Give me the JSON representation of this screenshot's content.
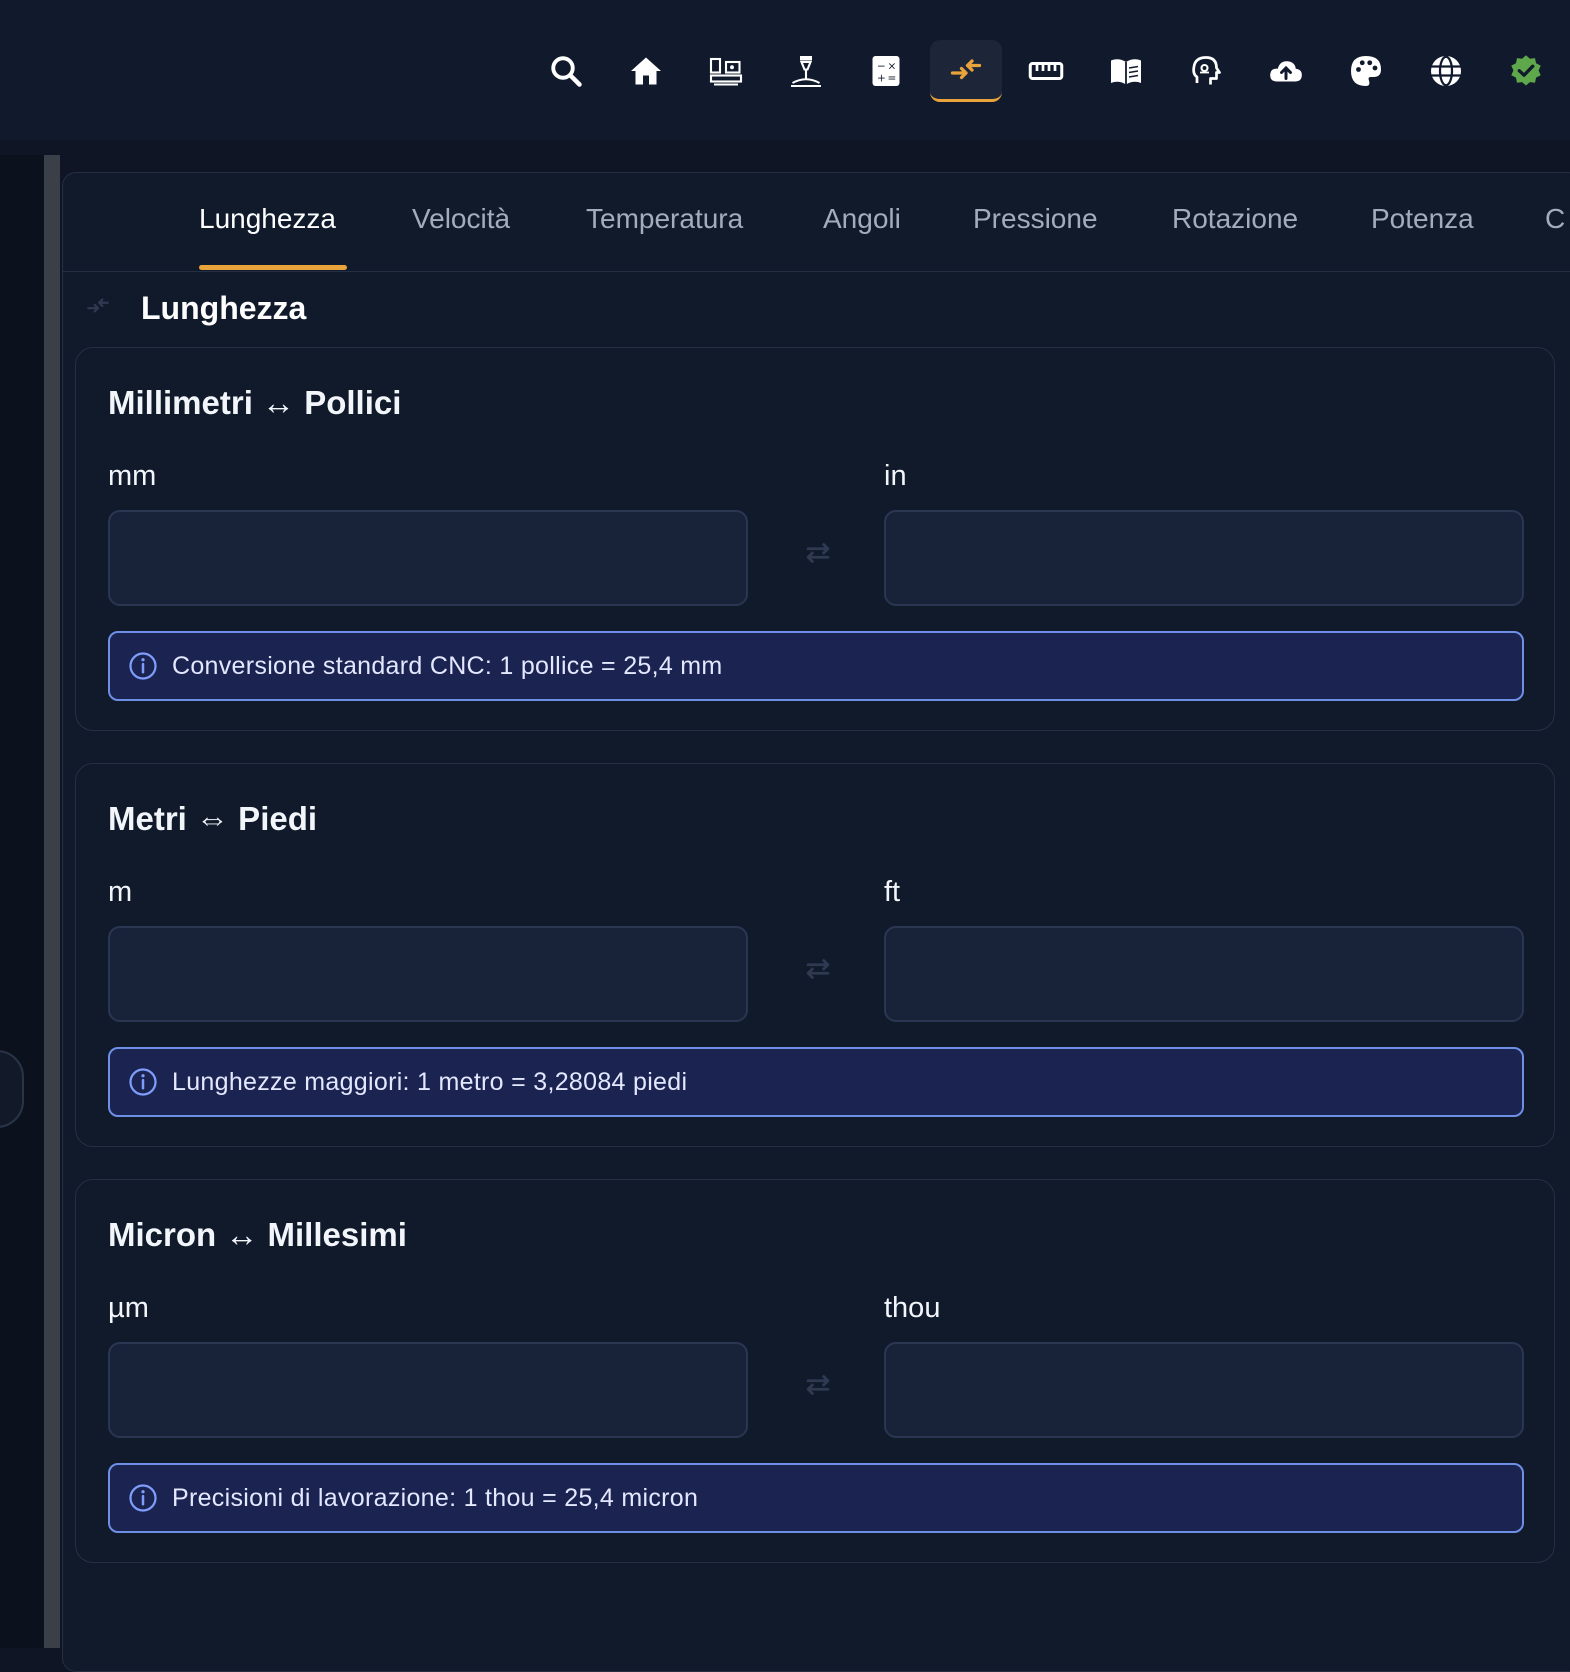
{
  "nav": {
    "icons": [
      "search-icon",
      "home-icon",
      "cnc-machine-icon",
      "laser-icon",
      "calculator-icon",
      "convert-icon",
      "ruler-icon",
      "book-icon",
      "ai-head-icon",
      "cloud-upload-icon",
      "palette-icon",
      "globe-icon",
      "verified-badge-icon"
    ],
    "active": "convert-icon",
    "accent_color": "#e8a33a",
    "badge_color": "#5ea84b"
  },
  "tabs": [
    "Lunghezza",
    "Velocità",
    "Temperatura",
    "Angoli",
    "Pressione",
    "Rotazione",
    "Potenza",
    "C"
  ],
  "active_tab": "Lunghezza",
  "section_title": "Lunghezza",
  "cards": [
    {
      "title": "Millimetri ↔ Pollici",
      "left_label": "mm",
      "left_value": "",
      "right_label": "in",
      "right_value": "",
      "info": "Conversione standard CNC: 1 pollice = 25,4 mm"
    },
    {
      "title": "Metri ⇔ Piedi",
      "left_label": "m",
      "left_value": "",
      "right_label": "ft",
      "right_value": "",
      "info": "Lunghezze maggiori: 1 metro = 3,28084 piedi"
    },
    {
      "title": "Micron ↔ Millesimi",
      "left_label": "µm",
      "left_value": "",
      "right_label": "thou",
      "right_value": "",
      "info": "Precisioni di lavorazione: 1 thou = 25,4 micron"
    }
  ]
}
